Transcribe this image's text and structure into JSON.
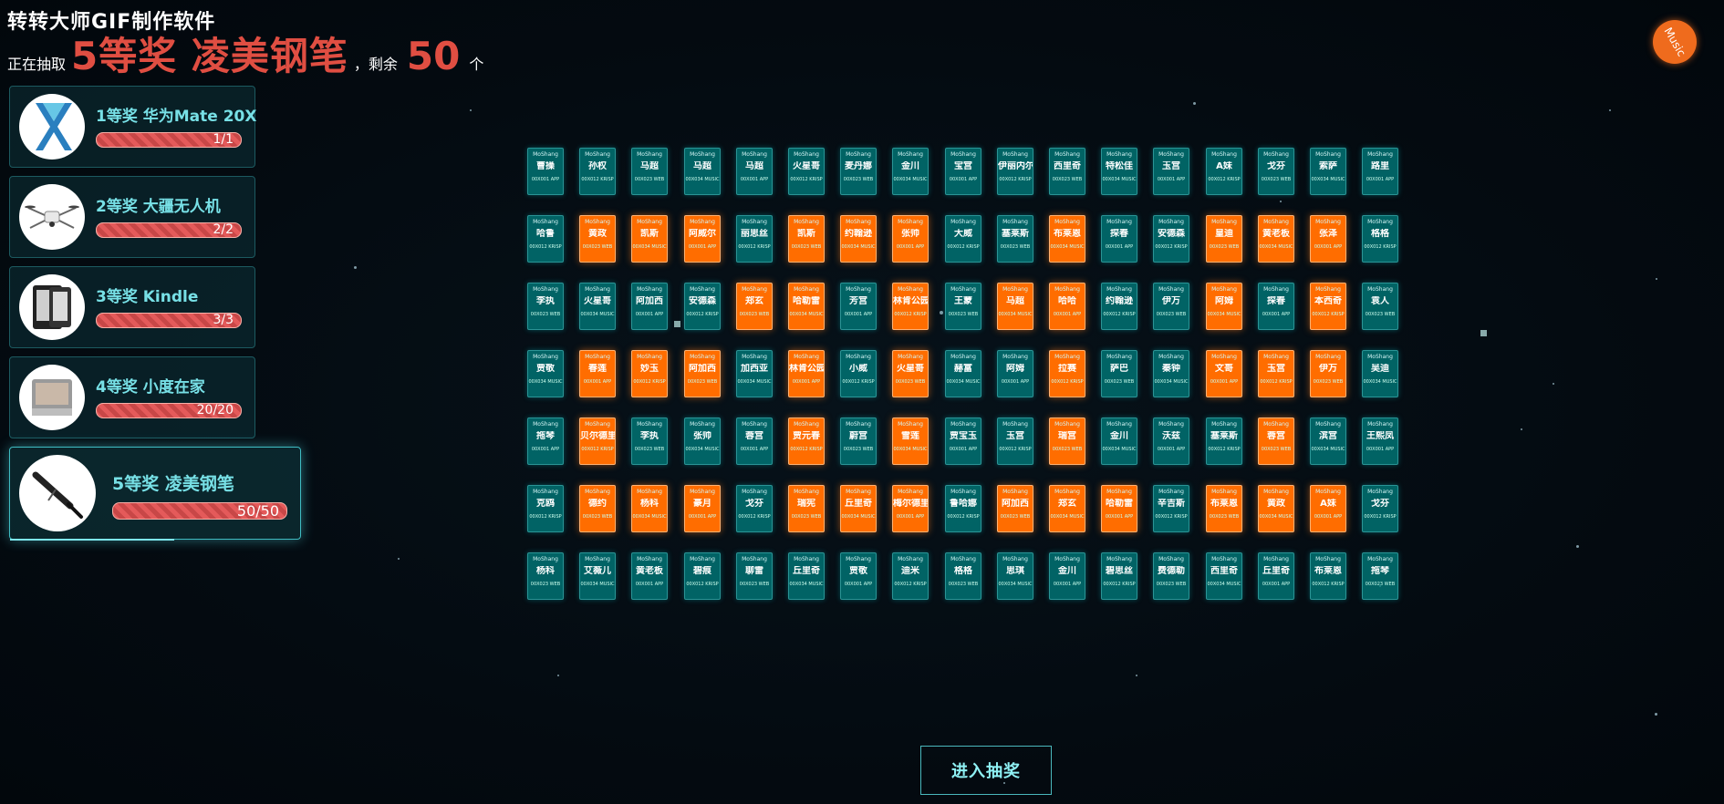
{
  "watermark": "转转大师GIF制作软件",
  "status": {
    "drawing_label": "正在抽取",
    "current_prize": "5等奖 凌美钢笔",
    "remaining_label": "，剩余",
    "remaining_count": "50",
    "unit": "个"
  },
  "music_button": {
    "label": "Music"
  },
  "prizes": [
    {
      "title": "1等奖 华为Mate 20X",
      "count": "1/1",
      "icon": "phone-icon"
    },
    {
      "title": "2等奖 大疆无人机",
      "count": "2/2",
      "icon": "drone-icon"
    },
    {
      "title": "3等奖 Kindle",
      "count": "3/3",
      "icon": "ereader-icon"
    },
    {
      "title": "4等奖 小度在家",
      "count": "20/20",
      "icon": "smart-display-icon"
    },
    {
      "title": "5等奖 凌美钢笔",
      "count": "50/50",
      "icon": "pen-icon"
    }
  ],
  "cards": {
    "company": "MoShang",
    "rows": [
      [
        "曹操",
        "孙权",
        "马超",
        "马超",
        "马超",
        "火星哥",
        "麦丹娜",
        "金川",
        "宝宫",
        "伊丽内尔",
        "西里奇",
        "特松佳",
        "玉宫",
        "A妹",
        "戈芬",
        "索萨",
        "路里"
      ],
      [
        "哈鲁",
        "黄政",
        "凯斯",
        "阿威尔",
        "丽思丝",
        "凯斯",
        "约翰逊",
        "张帅",
        "大威",
        "塞莱斯",
        "布莱恩",
        "探春",
        "安德森",
        "皇迪",
        "黄老板",
        "张泽",
        "格格"
      ],
      [
        "李执",
        "火星哥",
        "阿加西",
        "安德森",
        "郑玄",
        "哈勒雷",
        "芳宫",
        "林肯公园",
        "王蒙",
        "马超",
        "哈哈",
        "约翰逊",
        "伊万",
        "阿姆",
        "探春",
        "本西奇",
        "袁人"
      ],
      [
        "贾敬",
        "春莲",
        "妙玉",
        "阿加西",
        "加西亚",
        "林肯公园",
        "小威",
        "火星哥",
        "赫富",
        "阿姆",
        "拉赛",
        "萨巴",
        "秦钟",
        "文哥",
        "玉宫",
        "伊万",
        "吴迪"
      ],
      [
        "拖琴",
        "贝尔德里",
        "李执",
        "张帅",
        "蓉宫",
        "贾元春",
        "蔚宫",
        "雪莲",
        "贾宝玉",
        "玉宫",
        "瑞宫",
        "金川",
        "沃兹",
        "塞莱斯",
        "蓉宫",
        "滨宫",
        "王熙凤"
      ],
      [
        "克鸥",
        "德约",
        "杨科",
        "豪月",
        "戈芬",
        "瑞宪",
        "丘里奇",
        "梅尔德里",
        "鲁哈娜",
        "阿加西",
        "郑玄",
        "哈勒雷",
        "辛吉斯",
        "布莱恩",
        "黄政",
        "A妹",
        "戈芬"
      ],
      [
        "杨科",
        "艾薇儿",
        "黄老板",
        "碧痕",
        "聊雷",
        "丘里奇",
        "贾敬",
        "迪米",
        "格格",
        "思琪",
        "金川",
        "碧思丝",
        "费德勒",
        "西里奇",
        "丘里奇",
        "布莱恩",
        "拖琴"
      ]
    ],
    "meta": [
      "00X001 APP",
      "00X012 KRISP",
      "00X023 WEB",
      "00X034 MUSIC"
    ],
    "highlight_rows": [
      [],
      [
        1,
        2,
        3,
        5,
        6,
        7,
        10,
        13,
        14,
        15
      ],
      [
        4,
        5,
        7,
        9,
        10,
        13,
        15
      ],
      [
        1,
        2,
        3,
        5,
        7,
        10,
        13,
        14,
        15
      ],
      [
        1,
        5,
        7,
        10,
        14
      ],
      [
        1,
        2,
        3,
        5,
        6,
        7,
        9,
        10,
        11,
        13,
        14,
        15
      ],
      []
    ]
  },
  "enter_button": {
    "label": "进入抽奖"
  }
}
